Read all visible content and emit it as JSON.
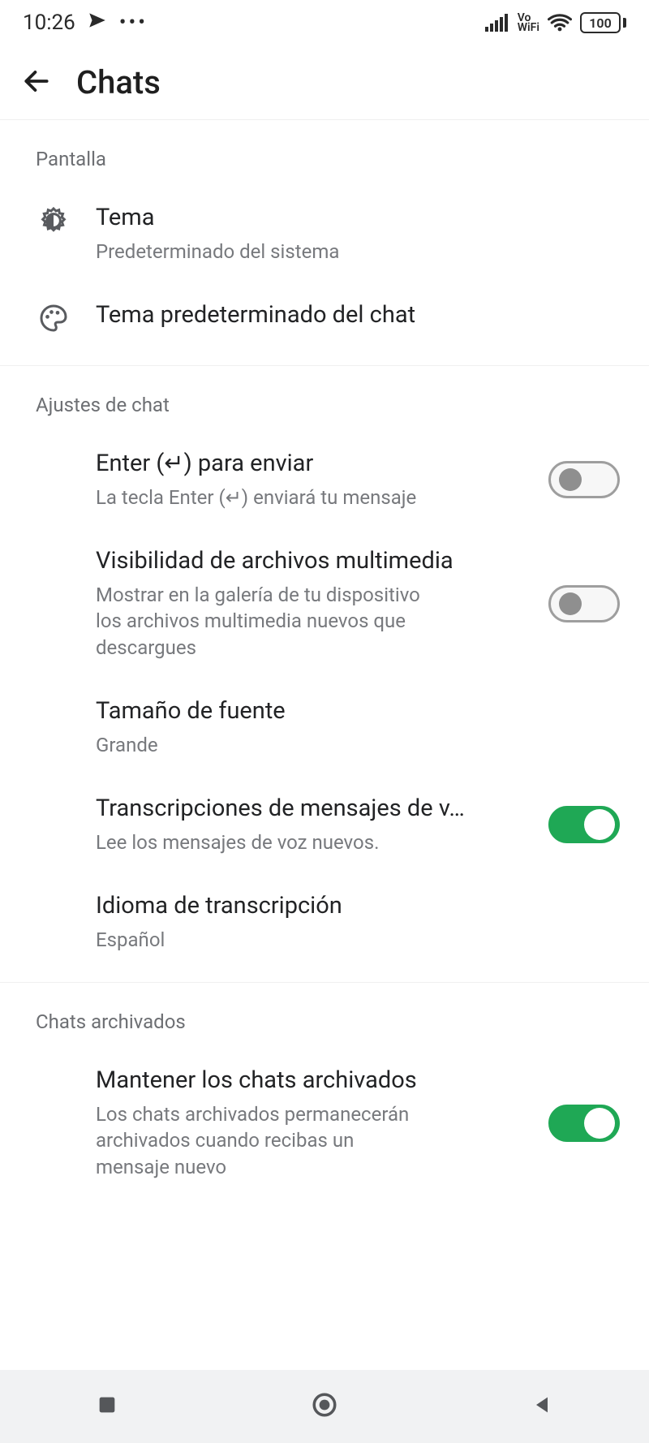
{
  "status": {
    "time": "10:26",
    "battery": "100"
  },
  "appbar": {
    "title": "Chats"
  },
  "sections": {
    "display": {
      "header": "Pantalla",
      "theme": {
        "title": "Tema",
        "subtitle": "Predeterminado del sistema"
      },
      "chat_theme": {
        "title": "Tema predeterminado del chat"
      }
    },
    "chat_settings": {
      "header": "Ajustes de chat",
      "enter_send": {
        "title": "Enter (↵) para enviar",
        "subtitle": "La tecla Enter (↵) enviará tu mensaje",
        "on": false
      },
      "media_visibility": {
        "title": "Visibilidad de archivos multimedia",
        "subtitle": "Mostrar en la galería de tu dispositivo los archivos multimedia nuevos que descargues",
        "on": false
      },
      "font_size": {
        "title": "Tamaño de fuente",
        "subtitle": "Grande"
      },
      "voice_transcripts": {
        "title": "Transcripciones de mensajes de v…",
        "subtitle": "Lee los mensajes de voz nuevos.",
        "on": true
      },
      "transcript_language": {
        "title": "Idioma de transcripción",
        "subtitle": "Español"
      }
    },
    "archived": {
      "header": "Chats archivados",
      "keep_archived": {
        "title": "Mantener los chats archivados",
        "subtitle": "Los chats archivados permanecerán archivados cuando recibas un mensaje nuevo",
        "on": true
      }
    }
  }
}
